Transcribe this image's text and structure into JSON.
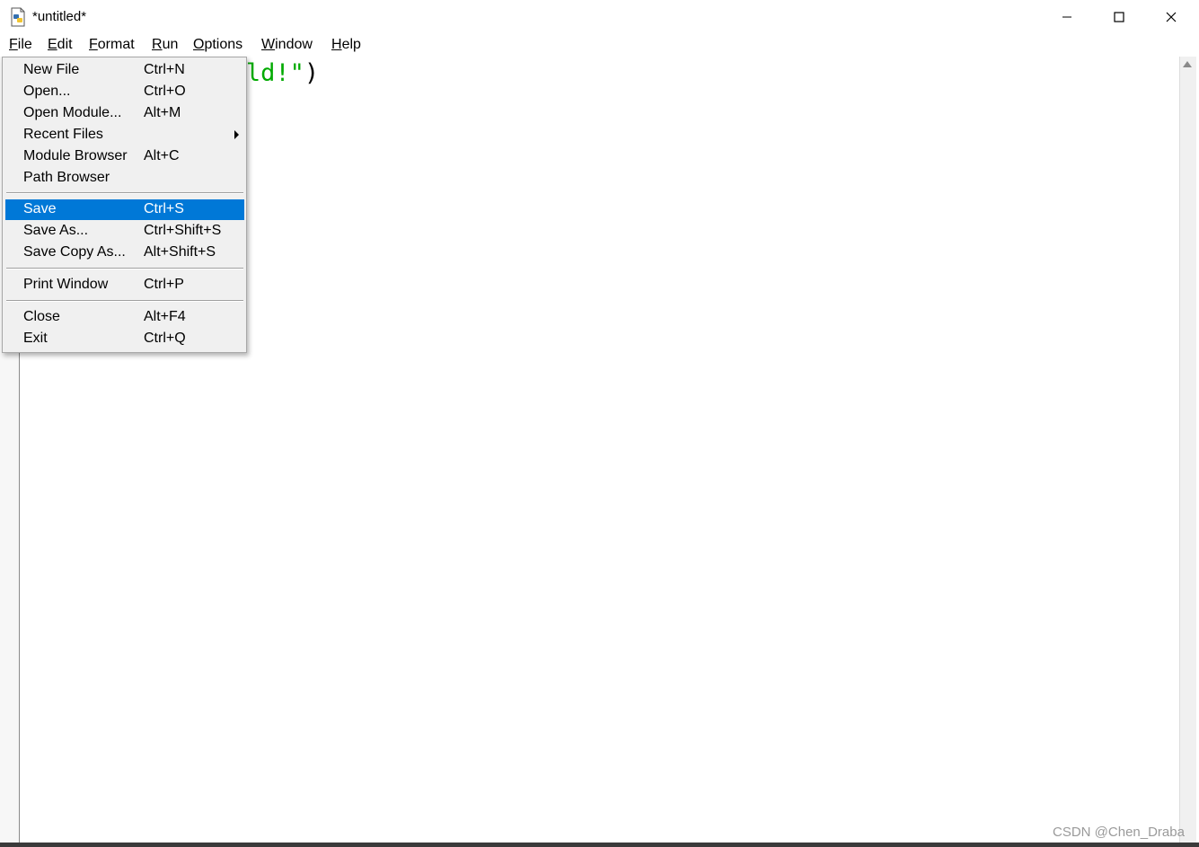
{
  "window": {
    "title": "*untitled*",
    "minimize_icon": "minimize-icon",
    "maximize_icon": "maximize-icon",
    "close_icon": "close-icon"
  },
  "menubar": {
    "items": [
      "File",
      "Edit",
      "Format",
      "Run",
      "Options",
      "Window",
      "Help"
    ]
  },
  "editor": {
    "visible_code": "rld!\")",
    "string_color": "#00aa00"
  },
  "file_menu": {
    "items": [
      {
        "label": "New File",
        "shortcut": "Ctrl+N"
      },
      {
        "label": "Open...",
        "shortcut": "Ctrl+O"
      },
      {
        "label": "Open Module...",
        "shortcut": "Alt+M"
      },
      {
        "label": "Recent Files",
        "shortcut": ""
      },
      {
        "label": "Module Browser",
        "shortcut": "Alt+C"
      },
      {
        "label": "Path Browser",
        "shortcut": ""
      },
      {
        "label": "Save",
        "shortcut": "Ctrl+S"
      },
      {
        "label": "Save As...",
        "shortcut": "Ctrl+Shift+S"
      },
      {
        "label": "Save Copy As...",
        "shortcut": "Alt+Shift+S"
      },
      {
        "label": "Print Window",
        "shortcut": "Ctrl+P"
      },
      {
        "label": "Close",
        "shortcut": "Alt+F4"
      },
      {
        "label": "Exit",
        "shortcut": "Ctrl+Q"
      }
    ],
    "selected": "Save",
    "highlight_color": "#0078d7"
  },
  "watermark": "CSDN @Chen_Draba"
}
